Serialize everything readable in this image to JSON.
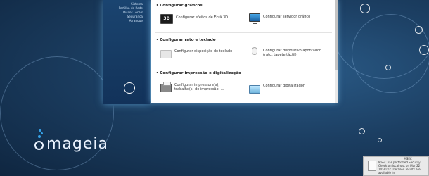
{
  "sidebar": {
    "items": [
      {
        "label": "Sistema"
      },
      {
        "label": "Partilha de Rede"
      },
      {
        "label": "Discos Locais"
      },
      {
        "label": "Segurança"
      },
      {
        "label": "Arranque"
      }
    ]
  },
  "sections": [
    {
      "title": "Configurar gráficos",
      "tools": [
        {
          "label": "Configurar efeitos de Ecrã 3D",
          "icon": "3d-effects-icon",
          "icon_text": "3D"
        },
        {
          "label": "Configurar servidor gráfico",
          "icon": "monitor-icon"
        }
      ]
    },
    {
      "title": "Configurar rato e teclado",
      "tools": [
        {
          "label": "Configurar disposição do teclado",
          "icon": "keyboard-icon"
        },
        {
          "label_lines": [
            "Configurar dispositivo apontador",
            "(rato, tapete táctil)"
          ],
          "icon": "mouse-icon"
        }
      ]
    },
    {
      "title": "Configurar impressão e digitalização",
      "tools": [
        {
          "label_lines": [
            "Configurar impressora(s),",
            "trabalho(s) de impressão, ..."
          ],
          "icon": "printer-icon"
        },
        {
          "label": "Configurar digitalizador",
          "icon": "scanner-icon"
        }
      ]
    }
  ],
  "logo": {
    "text": "mageia"
  },
  "notification": {
    "title": "MSEC",
    "lines": [
      "MSEC has performed Security",
      "Check on localhost on Mar 22",
      "14:30:07. Detailed results are",
      "available in"
    ]
  },
  "colors": {
    "accent": "#36a3e8",
    "desktop_bg": "#1c3f63",
    "panel_bg": "#ffffff"
  }
}
